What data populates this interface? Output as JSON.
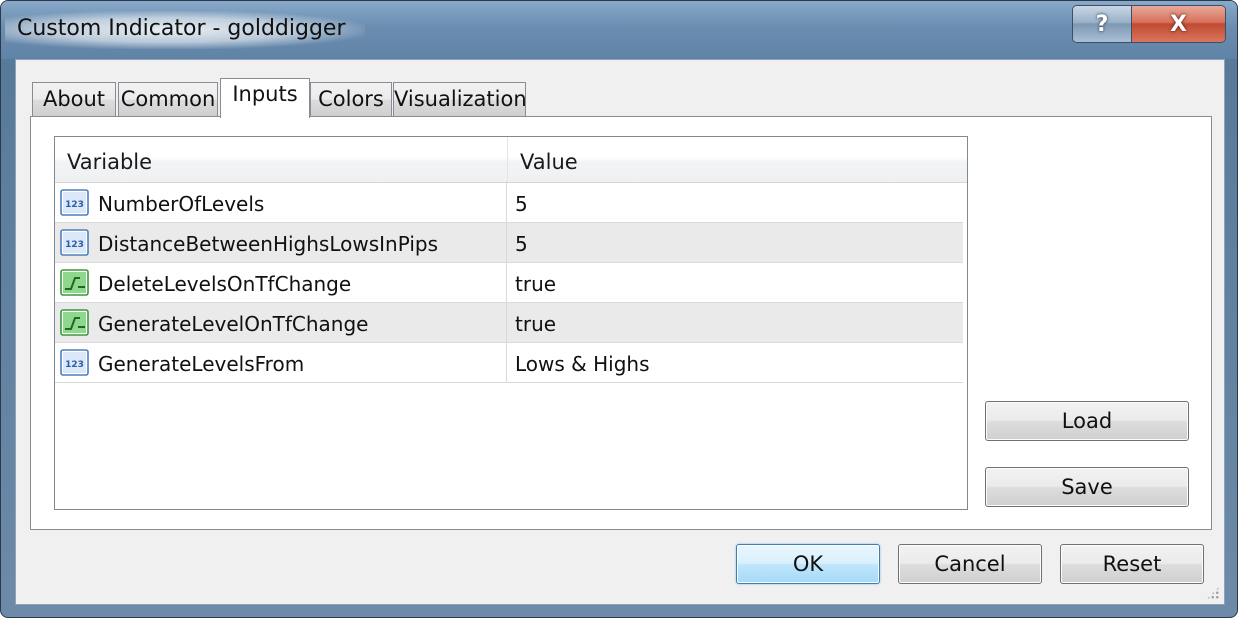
{
  "window": {
    "title": "Custom Indicator - golddigger",
    "help_label": "?",
    "close_label": "X"
  },
  "tabs": [
    {
      "label": "About",
      "active": false
    },
    {
      "label": "Common",
      "active": false
    },
    {
      "label": "Inputs",
      "active": true
    },
    {
      "label": "Colors",
      "active": false
    },
    {
      "label": "Visualization",
      "active": false
    }
  ],
  "grid": {
    "columns": [
      "Variable",
      "Value"
    ],
    "rows": [
      {
        "variable": "NumberOfLevels",
        "value": "5",
        "icon": "numeric-123-icon"
      },
      {
        "variable": "DistanceBetweenHighsLowsInPips",
        "value": "5",
        "icon": "numeric-123-icon"
      },
      {
        "variable": "DeleteLevelsOnTfChange",
        "value": "true",
        "icon": "boolean-toggle-icon"
      },
      {
        "variable": "GenerateLevelOnTfChange",
        "value": "true",
        "icon": "boolean-toggle-icon"
      },
      {
        "variable": "GenerateLevelsFrom",
        "value": "Lows & Highs",
        "icon": "numeric-123-icon"
      }
    ]
  },
  "side_buttons": {
    "load_label": "Load",
    "save_label": "Save"
  },
  "footer_buttons": {
    "ok_label": "OK",
    "cancel_label": "Cancel",
    "reset_label": "Reset"
  },
  "colors": {
    "numeric_icon": "#3a78c2",
    "boolean_icon": "#2ea02e",
    "default_button_border": "#3c7fb1"
  }
}
